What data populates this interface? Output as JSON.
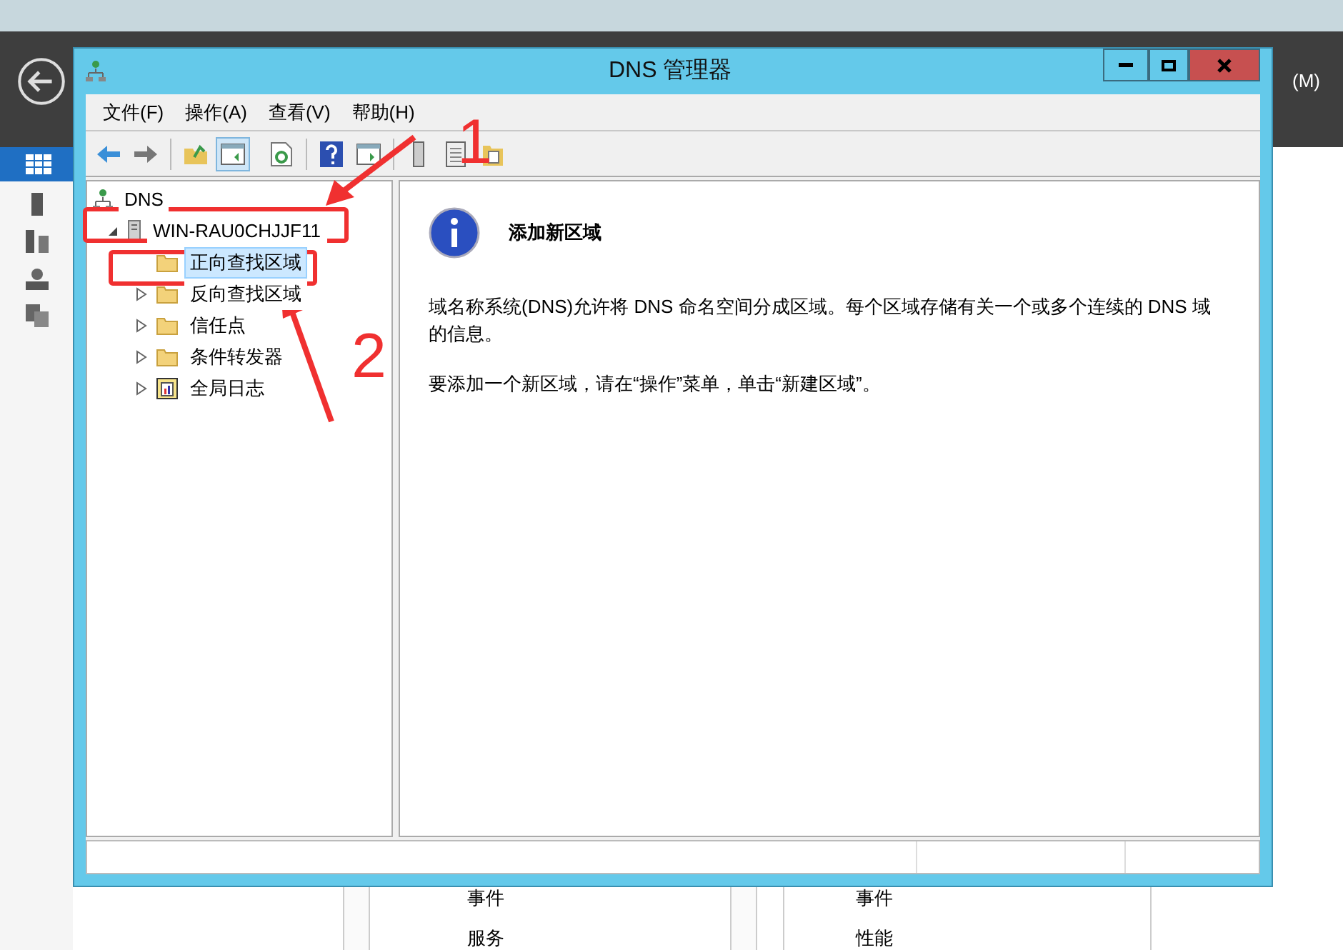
{
  "background": {
    "menu_suffix": "(M)",
    "panels": [
      {
        "items": [
          "事件",
          "服务"
        ]
      },
      {
        "items": [
          "事件",
          "性能"
        ]
      }
    ]
  },
  "window": {
    "title": "DNS 管理器"
  },
  "menu": [
    "文件(F)",
    "操作(A)",
    "查看(V)",
    "帮助(H)"
  ],
  "tree": [
    {
      "label": "DNS",
      "kind": "root",
      "selected": false,
      "children": [
        {
          "label": "WIN-RAU0CHJJF11",
          "kind": "server",
          "selected": false,
          "expanded": true,
          "children": [
            {
              "label": "正向查找区域",
              "kind": "folder",
              "selected": true
            },
            {
              "label": "反向查找区域",
              "kind": "folder",
              "selected": false,
              "expanded": false
            },
            {
              "label": "信任点",
              "kind": "folder",
              "selected": false,
              "expanded": false
            },
            {
              "label": "条件转发器",
              "kind": "folder",
              "selected": false,
              "expanded": false
            },
            {
              "label": "全局日志",
              "kind": "log",
              "selected": false,
              "expanded": false
            }
          ]
        }
      ]
    }
  ],
  "detail": {
    "title": "添加新区域",
    "paragraphs": [
      "域名称系统(DNS)允许将 DNS 命名空间分成区域。每个区域存储有关一个或多个连续的 DNS 域的信息。",
      "要添加一个新区域，请在“操作”菜单，单击“新建区域”。"
    ]
  },
  "annotations": [
    {
      "label": "1"
    },
    {
      "label": "2"
    }
  ]
}
